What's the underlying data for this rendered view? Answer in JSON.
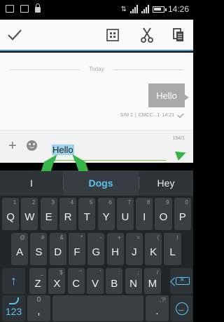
{
  "status_bar": {
    "time": "14:26"
  },
  "action_bar": {
    "done_icon": "check-icon",
    "select_all_icon": "select-all-icon",
    "cut_icon": "scissors-icon",
    "copy_icon": "copy-icon"
  },
  "conversation": {
    "date_separator": "Today",
    "messages": [
      {
        "text": "Hello",
        "sim": "SIM 2",
        "carrier": "CMCC...1",
        "time": "14:21",
        "status_icon": "delivered-check-icon"
      }
    ]
  },
  "compose": {
    "text": "Hello",
    "char_count": "154/1",
    "colors": {
      "accent": "#38b54a",
      "selection": "#9cd4f0"
    }
  },
  "keyboard": {
    "suggestions": [
      "I",
      "Dogs",
      "Hey"
    ],
    "row1": [
      {
        "k": "Q",
        "h": "1"
      },
      {
        "k": "W",
        "h": "2"
      },
      {
        "k": "E",
        "h": "3"
      },
      {
        "k": "R",
        "h": "4"
      },
      {
        "k": "T",
        "h": "5"
      },
      {
        "k": "Y",
        "h": "6"
      },
      {
        "k": "U",
        "h": "7"
      },
      {
        "k": "I",
        "h": "8"
      },
      {
        "k": "O",
        "h": "9"
      },
      {
        "k": "P",
        "h": "0"
      }
    ],
    "row2": [
      {
        "k": "A",
        "h": "@"
      },
      {
        "k": "S",
        "h": "#"
      },
      {
        "k": "D",
        "h": "&"
      },
      {
        "k": "F",
        "h": "*"
      },
      {
        "k": "G",
        "h": "-"
      },
      {
        "k": "H",
        "h": "+"
      },
      {
        "k": "J",
        "h": "="
      },
      {
        "k": "K",
        "h": "("
      },
      {
        "k": "L",
        "h": ")"
      }
    ],
    "row3": [
      {
        "k": "Z",
        "h": "_"
      },
      {
        "k": "X",
        "h": "$"
      },
      {
        "k": "C",
        "h": "\""
      },
      {
        "k": "V",
        "h": "'"
      },
      {
        "k": "B",
        "h": ":"
      },
      {
        "k": "N",
        "h": ";"
      },
      {
        "k": "M",
        "h": "/"
      }
    ],
    "number_key": "123",
    "comma_key": ",",
    "period_key": ".",
    "period_hint": ",?!",
    "colors": {
      "accent": "#5cc3f0",
      "background": "#202528",
      "key": "#3a3f43"
    }
  }
}
